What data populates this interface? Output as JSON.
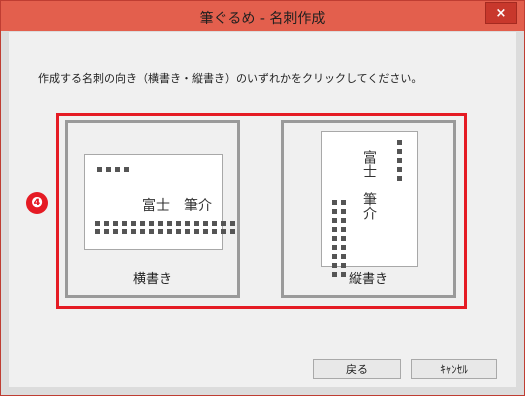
{
  "window": {
    "title": "筆ぐるめ - 名刺作成",
    "close_glyph": "×"
  },
  "instruction": "作成する名刺の向き（横書き・縦書き）のいずれかをクリックしてください。",
  "step_badge": "❹",
  "options": {
    "horizontal": {
      "label": "横書き",
      "sample_name": "富士　筆介"
    },
    "vertical": {
      "label": "縦書き",
      "sample_name": "富士　筆介"
    }
  },
  "buttons": {
    "back": "戻る",
    "cancel": "ｷｬﾝｾﾙ"
  },
  "colors": {
    "titlebar": "#e35f4d",
    "highlight": "#e51b24",
    "card_border": "#9a9a9a"
  }
}
